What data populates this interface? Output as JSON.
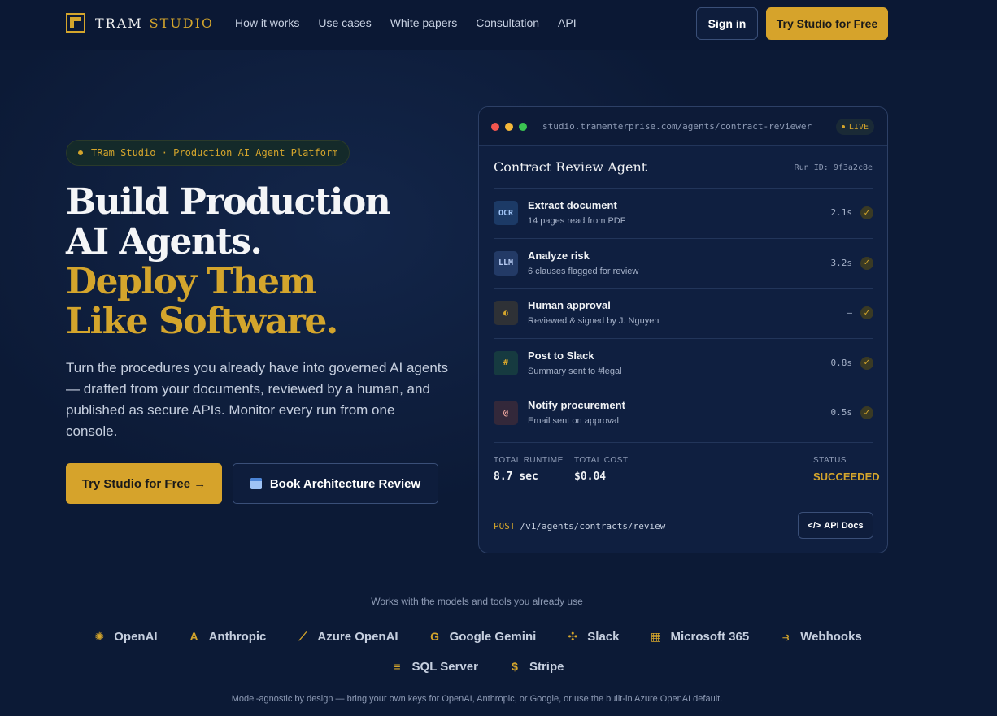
{
  "nav": {
    "logo_primary": "TRAM",
    "logo_secondary": "STUDIO",
    "links": [
      "How it works",
      "Use cases",
      "White papers",
      "Consultation",
      "API"
    ],
    "sign_in": "Sign in",
    "try_free": "Try Studio for Free"
  },
  "hero": {
    "pill": "TRam Studio · Production AI Agent Platform",
    "headline_white_1": "Build Production",
    "headline_white_2": "AI Agents.",
    "headline_gold_1": "Deploy Them",
    "headline_gold_2": "Like Software.",
    "description": "Turn the procedures you already have into governed AI agents — drafted from your documents, reviewed by a human, and published as secure APIs. Monitor every run from one console.",
    "cta_primary": "Try Studio for Free →",
    "cta_secondary": "Book Architecture Review"
  },
  "card": {
    "url": "studio.tramenterprise.com/agents/contract-reviewer",
    "live": "LIVE",
    "title": "Contract Review Agent",
    "run_id": "Run ID: 9f3a2c8e",
    "steps": [
      {
        "badge": "OCR",
        "name": "Extract document",
        "sub": "14 pages read from PDF",
        "time": "2.1s"
      },
      {
        "badge": "LLM",
        "name": "Analyze risk",
        "sub": "6 clauses flagged for review",
        "time": "3.2s"
      },
      {
        "badge": "◐",
        "name": "Human approval",
        "sub": "Reviewed & signed by J. Nguyen",
        "time": "—"
      },
      {
        "badge": "#",
        "name": "Post to Slack",
        "sub": "Summary sent to #legal",
        "time": "0.8s"
      },
      {
        "badge": "@",
        "name": "Notify procurement",
        "sub": "Email sent on approval",
        "time": "0.5s"
      }
    ],
    "summary": {
      "runtime_label": "TOTAL RUNTIME",
      "runtime_value": "8.7 sec",
      "cost_label": "TOTAL COST",
      "cost_value": "$0.04",
      "status_label": "STATUS",
      "status_value": "SUCCEEDED"
    },
    "endpoint_method": "POST",
    "endpoint_path": "/v1/agents/contracts/review",
    "api_docs": "API Docs"
  },
  "integrations": {
    "heading": "Works with the models and tools you already use",
    "row1": [
      "OpenAI",
      "Anthropic",
      "Azure OpenAI",
      "Google Gemini",
      "Slack",
      "Microsoft 365",
      "Webhooks"
    ],
    "row2": [
      "SQL Server",
      "Stripe"
    ],
    "footnote": "Model-agnostic by design — bring your own keys for OpenAI, Anthropic, or Google, or use the built-in Azure OpenAI default."
  },
  "colors": {
    "accent": "#d6a32b",
    "background": "#0c1a36"
  }
}
